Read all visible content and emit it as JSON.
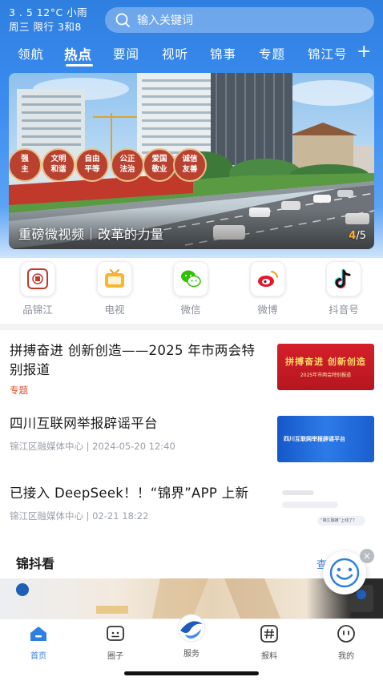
{
  "status": {
    "weather_line1": "3 . 5  12°C 小雨",
    "weather_line2": "周三  限行 3和8"
  },
  "search": {
    "placeholder": "输入关键词"
  },
  "tabs": [
    {
      "label": "领航"
    },
    {
      "label": "热点",
      "active": true
    },
    {
      "label": "要闻"
    },
    {
      "label": "视听"
    },
    {
      "label": "锦事"
    },
    {
      "label": "专题"
    },
    {
      "label": "锦江号"
    }
  ],
  "banner": {
    "caption": "重磅微视频｜改革的力量",
    "pager_current": "4",
    "pager_total": "/5",
    "barrel_words": [
      "强",
      "文明",
      "自由",
      "公正",
      "爱国",
      "诚信",
      "主",
      "和谐",
      "平等",
      "法治",
      "敬业",
      "友善"
    ]
  },
  "quick_links": [
    {
      "label": "品锦江",
      "icon": "seal-icon"
    },
    {
      "label": "电视",
      "icon": "tv-icon"
    },
    {
      "label": "微信",
      "icon": "wechat-icon"
    },
    {
      "label": "微博",
      "icon": "weibo-icon"
    },
    {
      "label": "抖音号",
      "icon": "douyin-icon"
    }
  ],
  "news": [
    {
      "title": "拼搏奋进 创新创造——2025 年市两会特别报道",
      "tag": "专题",
      "thumb_text": "拼搏奋进  创新创造",
      "thumb_sub": "2025年市两会特别报道"
    },
    {
      "title": "四川互联网举报辟谣平台",
      "meta": "锦江区融媒体中心 | 2024-05-20 12:40",
      "thumb_text": "四川互联网举报辟谣平台"
    },
    {
      "title": "已接入 DeepSeek！！“锦界”APP 上新",
      "meta": "锦江区融媒体中心 | 02-21 18:22",
      "thumb_text": "“锦江融媒”上线了？"
    }
  ],
  "section": {
    "title": "锦抖看",
    "more": "查看更多"
  },
  "bottom_nav": [
    {
      "label": "首页",
      "icon": "home-icon",
      "active": true
    },
    {
      "label": "圈子",
      "icon": "circle-chat-icon"
    },
    {
      "label": "服务",
      "icon": "logo-icon"
    },
    {
      "label": "报料",
      "icon": "hash-icon"
    },
    {
      "label": "我的",
      "icon": "profile-icon"
    }
  ],
  "colors": {
    "brand_blue": "#2f7fe0",
    "tag_red": "#e0502f",
    "pager_orange": "#ffb02e"
  }
}
